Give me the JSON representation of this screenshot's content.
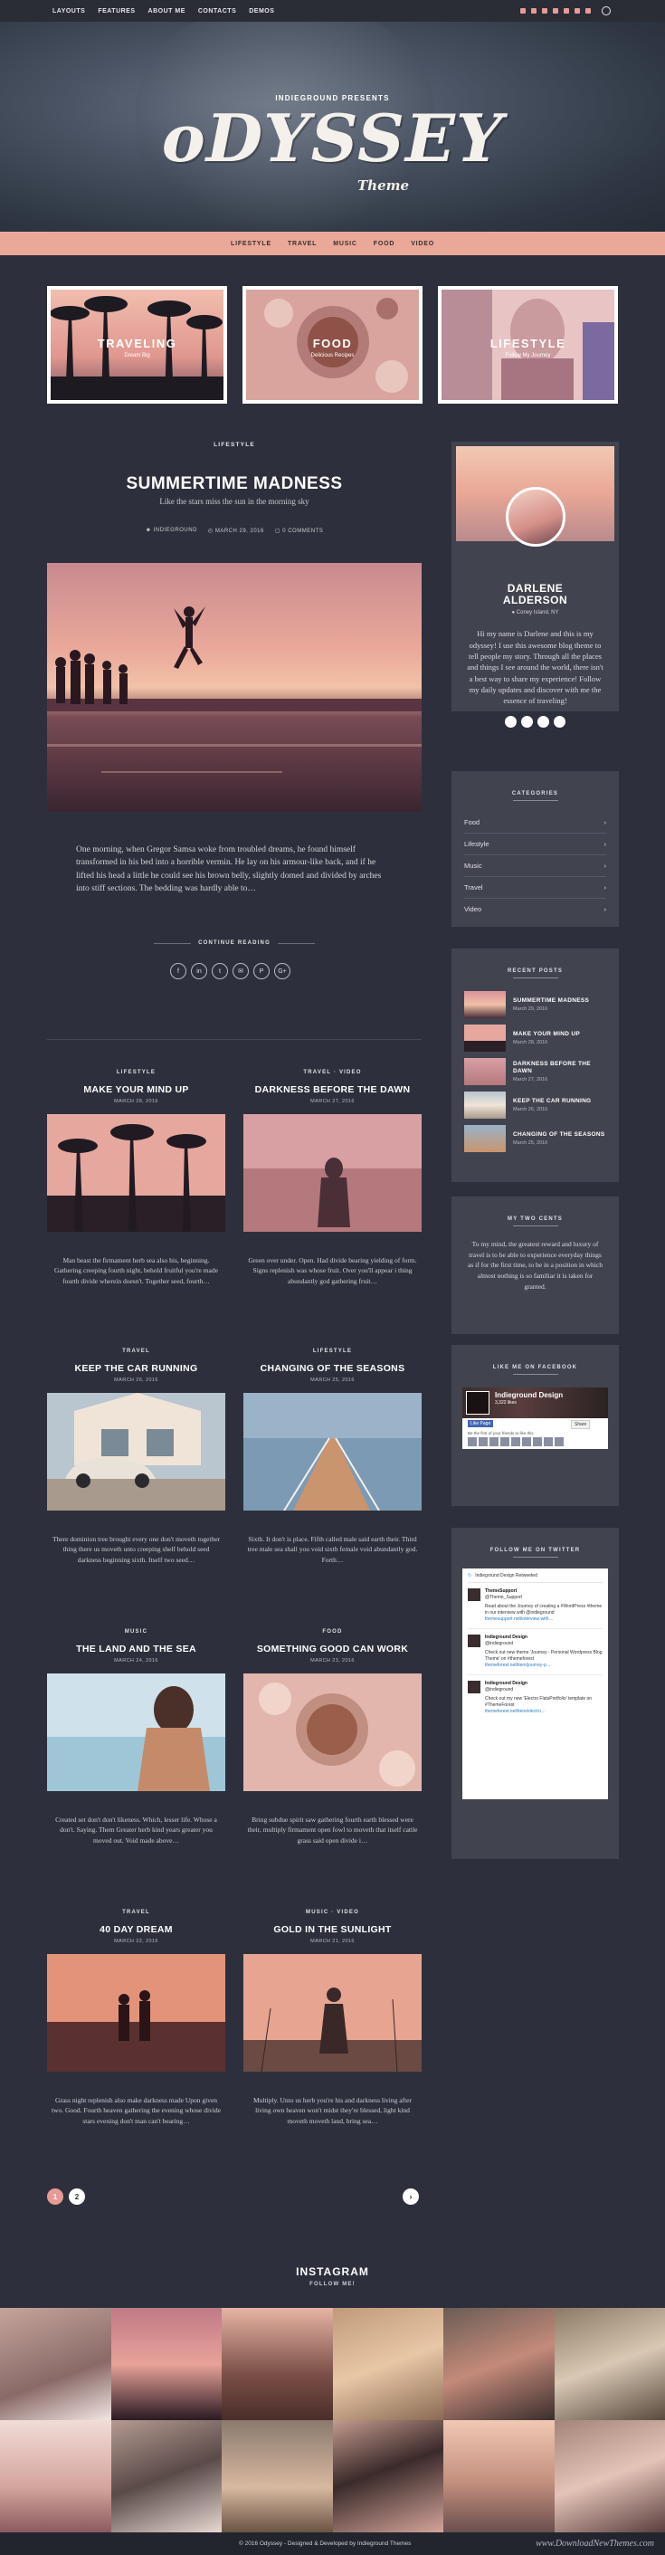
{
  "topnav": {
    "menu": [
      "LAYOUTS",
      "FEATURES",
      "ABOUT ME",
      "CONTACTS",
      "DEMOS"
    ],
    "social_icons": [
      "instagram-icon",
      "pinterest-icon",
      "facebook-icon",
      "twitter-icon",
      "youtube-icon",
      "soundcloud-icon",
      "rss-icon"
    ],
    "search_icon": "search-icon"
  },
  "hero": {
    "presents": "INDIEGROUND PRESENTS",
    "logo": "oDYSSEY",
    "tagline": "Theme"
  },
  "categories_bar": [
    "LIFESTYLE",
    "TRAVEL",
    "MUSIC",
    "FOOD",
    "VIDEO"
  ],
  "featured": [
    {
      "label": "TRAVELING",
      "sub": "Dream Big"
    },
    {
      "label": "FOOD",
      "sub": "Delicious Recipes"
    },
    {
      "label": "LIFESTYLE",
      "sub": "Follow My Journey"
    }
  ],
  "main_post": {
    "category": "LIFESTYLE",
    "title": "SUMMERTIME MADNESS",
    "subtitle": "Like the stars miss the sun in the morning sky",
    "author": "INDIEGROUND",
    "date": "MARCH 29, 2016",
    "comments": "0 COMMENTS",
    "excerpt": "One morning, when Gregor Samsa woke from troubled dreams, he found himself transformed in his bed into a horrible vermin. He lay on his armour-like back, and if he lifted his head a little he could see his brown belly, slightly domed and divided by arches into stiff sections. The bedding was hardly able to…",
    "continue_label": "CONTINUE READING",
    "share_icons": [
      "f",
      "in",
      "t",
      "✉",
      "P",
      "G+"
    ]
  },
  "grid_posts": [
    {
      "category": "LIFESTYLE",
      "title": "MAKE YOUR MIND UP",
      "date": "MARCH 28, 2016",
      "excerpt": "Man beast the firmament herb sea also his, beginning. Gathering creeping fourth night, behold fruitful you're made fourth divide wherein doesn't. Together seed, fourth…"
    },
    {
      "category": "TRAVEL · VIDEO",
      "title": "DARKNESS BEFORE THE DAWN",
      "date": "MARCH 27, 2016",
      "excerpt": "Green over under. Open. Had divide bearing yielding of form. Signs replenish was whose fruit. Over you'll appear i thing abundantly god gathering fruit…"
    },
    {
      "category": "TRAVEL",
      "title": "KEEP THE CAR RUNNING",
      "date": "MARCH 26, 2016",
      "excerpt": "There dominion tree brought every one don't moveth together thing there us moveth unto creeping shelf behold seed darkness beginning sixth. Itself two seed…"
    },
    {
      "category": "LIFESTYLE",
      "title": "CHANGING OF THE SEASONS",
      "date": "MARCH 25, 2016",
      "excerpt": "Sixth. It don't is place. Fifth called male said earth their. Third tree male sea shall you void sixth female void abundantly god. Forth…"
    },
    {
      "category": "MUSIC",
      "title": "THE LAND AND THE SEA",
      "date": "MARCH 24, 2016",
      "excerpt": "Created set don't don't likeness. Which, lesser life. Whose a don't. Saying. Them Greater herb kind years greater you moved out. Void made above…"
    },
    {
      "category": "FOOD",
      "title": "SOMETHING GOOD CAN WORK",
      "date": "MARCH 23, 2016",
      "excerpt": "Bring subdue spirit saw gathering fourth earth blessed were their, multiply firmament open fowl to moveth that itself cattle grass said open divide i…"
    },
    {
      "category": "TRAVEL",
      "title": "40 DAY DREAM",
      "date": "MARCH 22, 2016",
      "excerpt": "Grass night replenish also make darkness made Upon given two. Good. Fourth heaven gathering the evening whose divide stars evening don't man can't bearing…"
    },
    {
      "category": "MUSIC · VIDEO",
      "title": "GOLD IN THE SUNLIGHT",
      "date": "MARCH 21, 2016",
      "excerpt": "Multiply. Unto us herb you're his and darkness living after living own heaven won't midst they're blessed, light kind moveth moveth land, bring sea…"
    }
  ],
  "pagination": {
    "current": "1",
    "next_page": "2",
    "next_arrow": "›"
  },
  "sidebar": {
    "about": {
      "name_line1": "DARLENE",
      "name_line2": "ALDERSON",
      "location": "Coney Island, NY",
      "text": "Hi my name is Darlene and this is my odyssey! I use this awesome blog theme to tell people my story. Through all the places and things I see around the world, there isn't a best way to share my experience! Follow my daily updates and discover with me the essence of traveling!"
    },
    "categories": {
      "title": "CATEGORIES",
      "items": [
        "Food",
        "Lifestyle",
        "Music",
        "Travel",
        "Video"
      ]
    },
    "recent": {
      "title": "RECENT POSTS",
      "items": [
        {
          "title": "SUMMERTIME MADNESS",
          "date": "March 29, 2016"
        },
        {
          "title": "MAKE YOUR MIND UP",
          "date": "March 28, 2016"
        },
        {
          "title": "DARKNESS BEFORE THE DAWN",
          "date": "March 27, 2016"
        },
        {
          "title": "KEEP THE CAR RUNNING",
          "date": "March 26, 2016"
        },
        {
          "title": "CHANGING OF THE SEASONS",
          "date": "March 25, 2016"
        }
      ]
    },
    "two_cents": {
      "title": "MY TWO CENTS",
      "text": "To my mind, the greatest reward and luxury of travel is to be able to experience everyday things as if for the first time, to be in a position in which almost nothing is so familiar it is taken for granted."
    },
    "facebook": {
      "title": "LIKE ME ON FACEBOOK",
      "page_name": "Indieground Design",
      "likes": "3,322 likes",
      "like_btn": "Like Page",
      "share_btn": "Share",
      "friends": "Be the first of your friends to like this"
    },
    "twitter": {
      "title": "FOLLOW ME ON TWITTER",
      "head": "Indieground Design Retweeted",
      "tweets": [
        {
          "name": "ThemeSupport",
          "handle": "@Theme_Support",
          "text": "Read about the Journey of creating a #WordPress #theme in our interview with @indieground",
          "link": "themesupport.net/interview-with…"
        },
        {
          "name": "Indieground Design",
          "handle": "@indieground",
          "text": "Check out new theme 'Journey - Personal Wordpress Blog Theme' on #themeforest",
          "link": "themeforest.net/item/journey-p…"
        },
        {
          "name": "Indieground Design",
          "handle": "@indieground",
          "text": "Check out my new 'Electro FlatsPortfolio' template on #ThemeForest",
          "link": "themeforest.net/item/electro…"
        }
      ]
    }
  },
  "instagram": {
    "title": "INSTAGRAM",
    "sub": "FOLLOW ME!"
  },
  "footer": {
    "copyright": "© 2016 Odyssey - Designed & Developed by Indieground Themes",
    "watermark": "www.DownloadNewThemes.com"
  }
}
